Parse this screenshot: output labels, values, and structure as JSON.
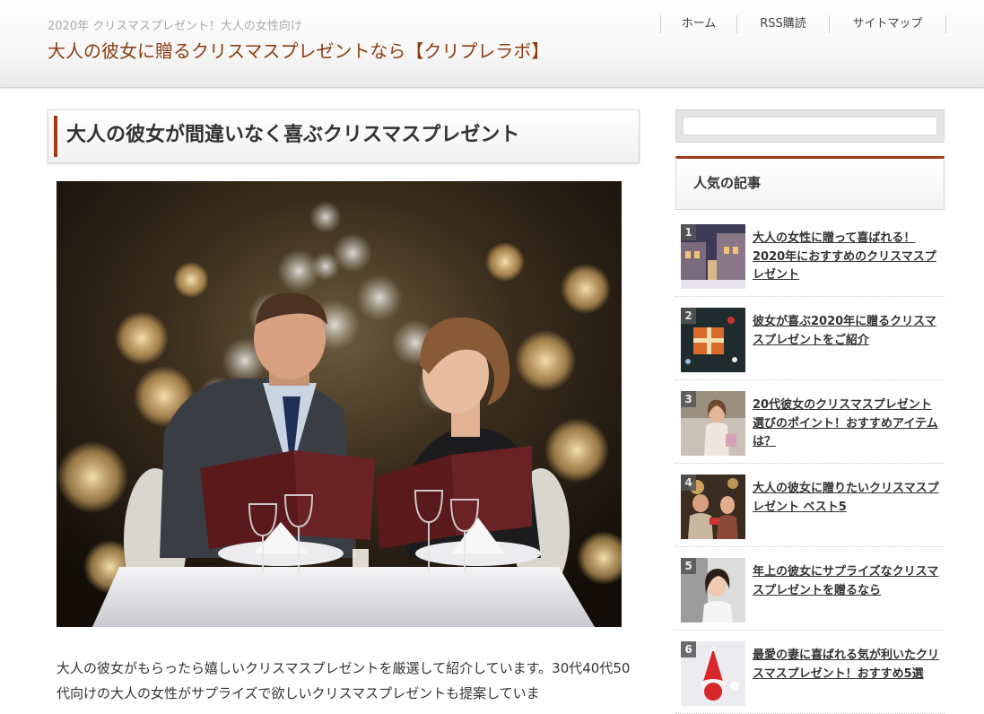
{
  "header": {
    "tagline": "2020年 クリスマスプレゼント！大人の女性向け",
    "site_title": "大人の彼女に贈るクリスマスプレゼントなら【クリプレラボ】",
    "nav": [
      {
        "label": "ホーム"
      },
      {
        "label": "RSS購読"
      },
      {
        "label": "サイトマップ"
      }
    ]
  },
  "main": {
    "heading": "大人の彼女が間違いなく喜ぶクリスマスプレゼント",
    "intro": "大人の彼女がもらったら嬉しいクリスマスプレゼントを厳選して紹介しています。30代40代50代向けの大人の女性がサプライズで欲しいクリスマスプレゼントも提案していま"
  },
  "sidebar": {
    "search": {
      "placeholder": ""
    },
    "popular_heading": "人気の記事",
    "popular": [
      {
        "rank": "1",
        "title": "大人の女性に贈って喜ばれる！2020年におすすめのクリスマスプレゼント"
      },
      {
        "rank": "2",
        "title": "彼女が喜ぶ2020年に贈るクリスマスプレゼントをご紹介"
      },
      {
        "rank": "3",
        "title": "20代彼女のクリスマスプレゼント選びのポイント！おすすめアイテムは？"
      },
      {
        "rank": "4",
        "title": "大人の彼女に贈りたいクリスマスプレゼント ベスト5"
      },
      {
        "rank": "5",
        "title": "年上の彼女にサプライズなクリスマスプレゼントを贈るなら"
      },
      {
        "rank": "6",
        "title": "最愛の妻に喜ばれる気が利いたクリスマスプレゼント！おすすめ5選"
      }
    ]
  },
  "colors": {
    "accent": "#a33a1a",
    "site_title": "#8b3c12"
  }
}
